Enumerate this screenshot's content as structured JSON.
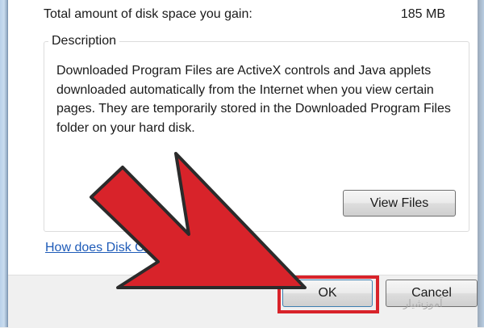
{
  "gain": {
    "label": "Total amount of disk space you gain:",
    "value": "185 MB"
  },
  "description": {
    "caption": "Description",
    "text": "Downloaded Program Files are ActiveX controls and Java applets downloaded automatically from the Internet when you view certain pages. They are temporarily stored in the Downloaded Program Files folder on your hard disk."
  },
  "buttons": {
    "view_files": "View Files",
    "ok": "OK",
    "cancel": "Cancel"
  },
  "help_link": "How does Disk Clea",
  "watermark": "آموزشیار",
  "annotation": {
    "arrow_color": "#d8232a",
    "highlight_color": "#d8232a",
    "points_to": "ok-button"
  }
}
